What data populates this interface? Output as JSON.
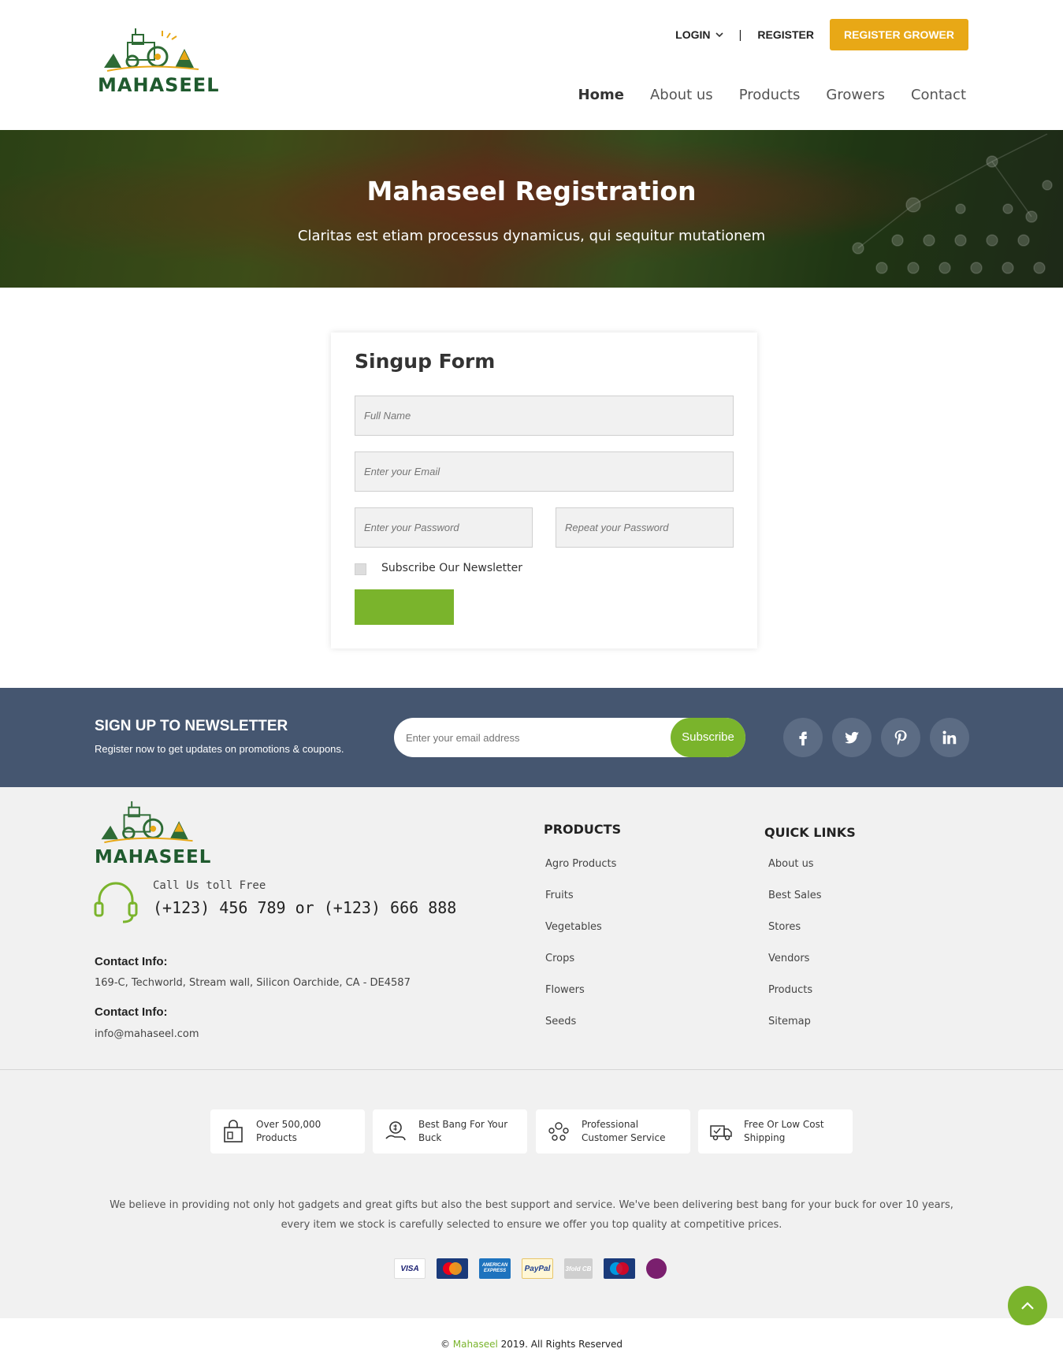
{
  "brand": {
    "name": "MAHASEEL",
    "accent": "#7ab42c",
    "gold": "#e8a816",
    "navy": "#455670"
  },
  "topbar": {
    "login": "LOGIN",
    "separator": "|",
    "register": "REGISTER",
    "register_grower": "REGISTER GROWER"
  },
  "nav": {
    "items": [
      "Home",
      "About us",
      "Products",
      "Growers",
      "Contact"
    ],
    "active": "Home"
  },
  "hero": {
    "title_light": "Mahaseel",
    "title_bold": "Registration",
    "subtitle": "Claritas est etiam processus dynamicus, qui sequitur mutationem"
  },
  "form": {
    "title": "Singup Form",
    "full_name_placeholder": "Full Name",
    "email_placeholder": "Enter your Email",
    "password_placeholder": "Enter your Password",
    "repeat_password_placeholder": "Repeat your Password",
    "newsletter_label": "Subscribe Our Newsletter",
    "newsletter_checked": false
  },
  "newsletter": {
    "title": "SIGN UP TO NEWSLETTER",
    "subtitle": "Register now to get updates on promotions & coupons.",
    "email_placeholder": "Enter your email address",
    "button": "Subscribe",
    "social": [
      "facebook-icon",
      "twitter-icon",
      "pinterest-icon",
      "linkedin-icon"
    ]
  },
  "footer": {
    "call_label": "Call Us toll Free",
    "phone": "(+123) 456 789 or (+123) 666 888",
    "contact_label_1": "Contact Info:",
    "address": "169-C, Techworld, Stream wall, Silicon Oarchide, CA - DE4587",
    "contact_label_2": "Contact Info:",
    "email": "info@mahaseel.com",
    "products_title": "PRODUCTS",
    "products": [
      "Agro Products",
      "Fruits",
      "Vegetables",
      "Crops",
      "Flowers",
      "Seeds"
    ],
    "quick_title": "QUICK LINKS",
    "quick_links": [
      "About us",
      "Best Sales",
      "Stores",
      "Vendors",
      "Products",
      "Sitemap"
    ],
    "features": [
      {
        "icon": "shopping-bag-icon",
        "line1": "Over 500,000",
        "line2": "Products"
      },
      {
        "icon": "money-hand-icon",
        "line1": "Best Bang For Your",
        "line2": "Buck"
      },
      {
        "icon": "customer-service-icon",
        "line1": "Professional",
        "line2": "Customer Service"
      },
      {
        "icon": "delivery-truck-icon",
        "line1": "Free Or Low Cost",
        "line2": "Shipping"
      }
    ],
    "about": "We believe in providing not only hot gadgets and great gifts but also the best support and service. We've been delivering best bang for your buck for over 10 years, every item we stock is carefully selected to ensure we offer you top quality at competitive prices.",
    "payments": [
      "VISA",
      "MasterCard",
      "AMERICAN EXPRESS",
      "PayPal",
      "3fold CB",
      "Maestro",
      "Be Smart"
    ]
  },
  "copyright": {
    "prefix": "©",
    "brand": "Mahaseel",
    "suffix": "2019. All Rights Reserved"
  }
}
